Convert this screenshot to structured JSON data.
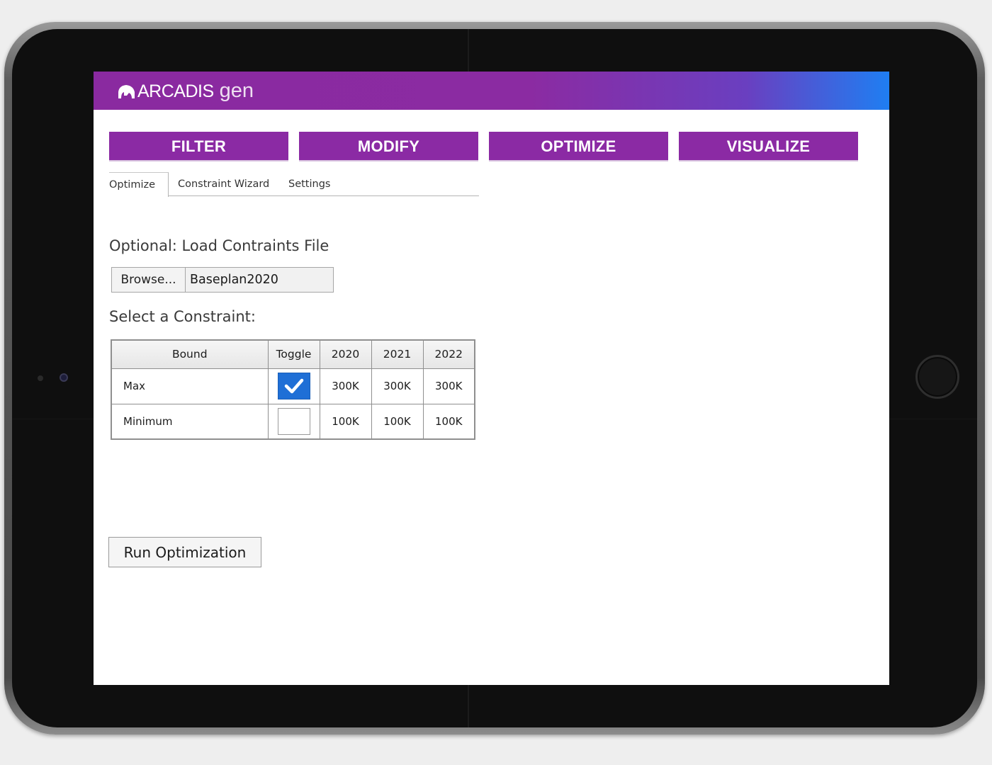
{
  "brand": {
    "name": "ARCADIS",
    "product": "gen"
  },
  "nav": [
    {
      "label": "FILTER"
    },
    {
      "label": "MODIFY"
    },
    {
      "label": "OPTIMIZE"
    },
    {
      "label": "VISUALIZE"
    }
  ],
  "subtabs": [
    {
      "label": "Optimize",
      "active": true
    },
    {
      "label": "Constraint Wizard",
      "active": false
    },
    {
      "label": "Settings",
      "active": false
    }
  ],
  "load_section": {
    "label": "Optional: Load Contraints File",
    "browse_label": "Browse...",
    "file_name": "Baseplan2020"
  },
  "constraint_section": {
    "label": "Select a Constraint:",
    "columns": [
      "Bound",
      "Toggle",
      "2020",
      "2021",
      "2022"
    ],
    "rows": [
      {
        "bound": "Max",
        "toggle": true,
        "values": [
          "300K",
          "300K",
          "300K"
        ]
      },
      {
        "bound": "Minimum",
        "toggle": false,
        "values": [
          "100K",
          "100K",
          "100K"
        ]
      }
    ]
  },
  "run_button": {
    "label": "Run Optimization"
  },
  "colors": {
    "accent": "#8b2aa4",
    "header_gradient_end": "#1f7ef2",
    "checkbox_checked": "#1f6fd6"
  }
}
